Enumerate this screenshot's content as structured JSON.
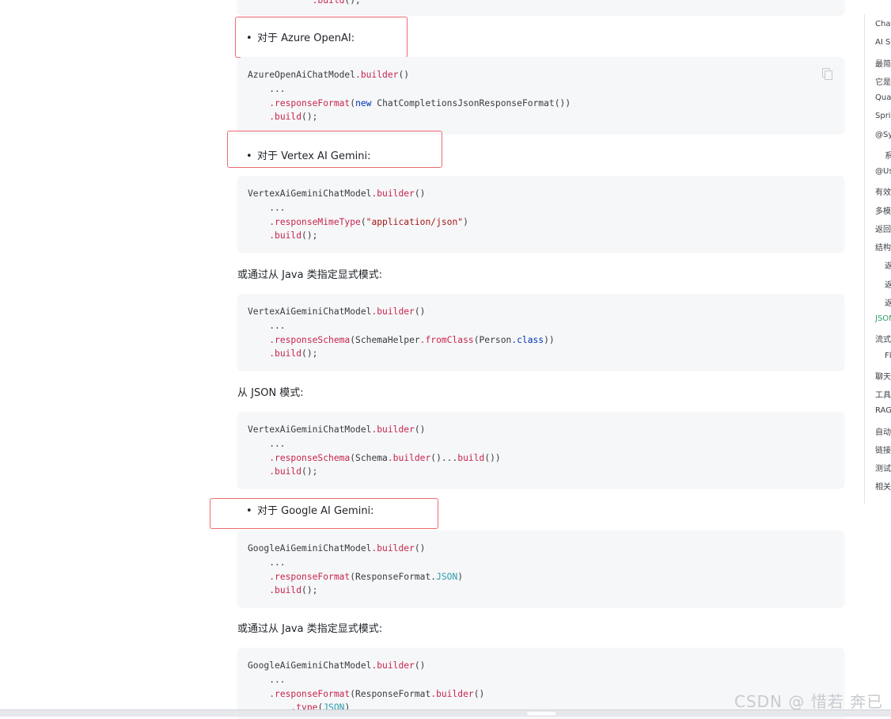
{
  "content": {
    "top_code_tail": "    .build();",
    "bullets": {
      "azure": "对于 Azure OpenAI:",
      "vertex": "对于 Vertex AI Gemini:",
      "google": "对于 Google AI Gemini:"
    },
    "paragraphs": {
      "p1": "或通过从 Java 类指定显式模式:",
      "p2": "从 JSON 模式:",
      "p3": "或通过从 Java 类指定显式模式:"
    }
  },
  "toc": {
    "items": [
      "Chat",
      "AI S",
      "最简",
      "它是",
      "Qua",
      "Spri",
      "@Sy",
      "系",
      "@Us",
      "有效",
      "多模",
      "返回",
      "结构",
      "返",
      "返",
      "返",
      "JSON",
      "流式",
      "Fl",
      "聊天",
      "工具",
      "RAG",
      "自动",
      "链接",
      "测试",
      "相关"
    ],
    "active_item": "JSON"
  },
  "watermark": "CSDN @ 惜若 奔已"
}
